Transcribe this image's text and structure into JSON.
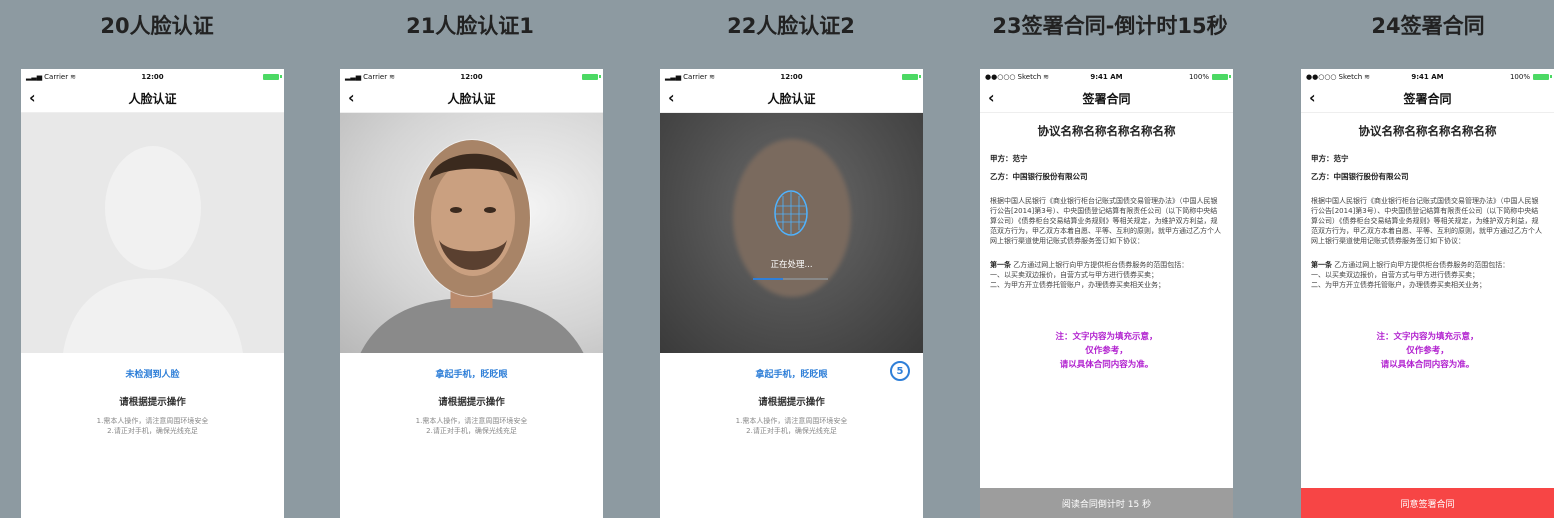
{
  "columns": [
    {
      "title": "20人脸认证"
    },
    {
      "title": "21人脸认证1"
    },
    {
      "title": "22人脸认证2"
    },
    {
      "title": "23签署合同-倒计时15秒"
    },
    {
      "title": "24签署合同"
    }
  ],
  "face_status": {
    "carrier": "Carrier",
    "time": "12:00"
  },
  "contract_status": {
    "carrier": "Sketch",
    "time": "9:41 AM",
    "battery": "100%"
  },
  "face": {
    "nav_title": "人脸认证",
    "prompt_none": "未检测到人脸",
    "prompt_blink": "拿起手机，眨眨眼",
    "subprompt": "请根据提示操作",
    "tip1": "1.需本人操作，请注意周围环境安全",
    "tip2": "2.请正对手机，确保光线充足",
    "processing": "正在处理...",
    "countdown": "5"
  },
  "contract": {
    "nav_title": "签署合同",
    "title": "协议名称名称名称名称名称",
    "party_a": "甲方：范宁",
    "party_b": "乙方：中国银行股份有限公司",
    "para": "根据中国人民银行《商业银行柜台记账式国债交易管理办法》（中国人民银行公告[2014]第3号）、中央国债登记结算有限责任公司（以下简称中央结算公司）《债券柜台交易结算业务规则》等相关规定，为维护双方利益，规范双方行为，甲乙双方本着自愿、平等、互利的原则，就甲方通过乙方个人网上银行渠道使用记账式债券服务签订如下协议：",
    "article_head": "第一条",
    "article_body": " 乙方通过网上银行向甲方提供柜台债券服务的范围包括：",
    "item1": "一、以买卖双边报价，自营方式与甲方进行债券买卖；",
    "item2": "二、为甲方开立债券托管账户，办理债券买卖相关业务；",
    "note1": "注：文字内容为填充示意，",
    "note2": "仅作参考，",
    "note3": "请以具体合同内容为准。",
    "btn_countdown": "阅读合同倒计时 15 秒",
    "btn_agree": "同意签署合同"
  },
  "colors": {
    "accent": "#2f7fd8",
    "note": "#b11fcf",
    "agree": "#f74545",
    "disabled": "#9d9d9d"
  }
}
